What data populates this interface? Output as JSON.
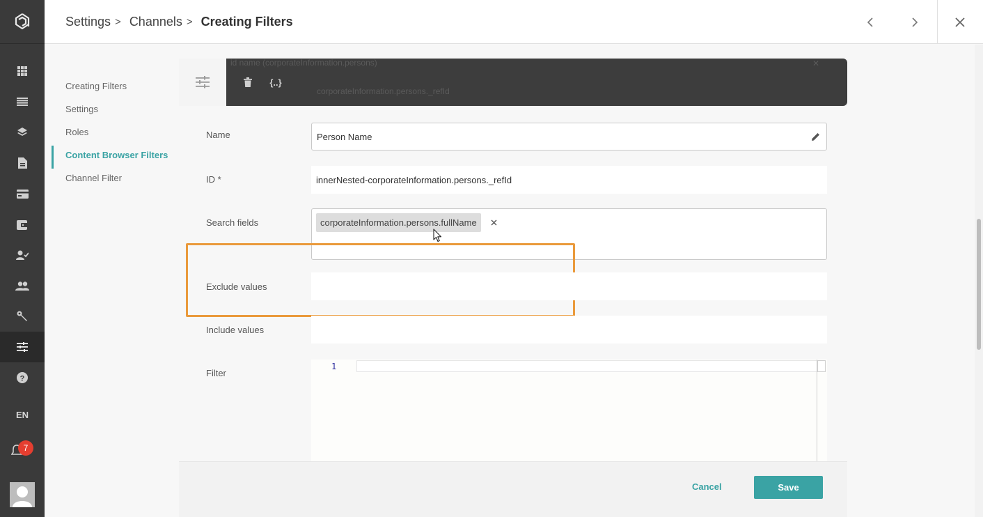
{
  "rail": {
    "icons": [
      "logo-icon",
      "grid-icon",
      "list-icon",
      "layers-icon",
      "document-icon",
      "card-icon",
      "wallet-icon",
      "person-check-icon",
      "people-icon",
      "wrench-icon",
      "sliders-icon",
      "help-icon"
    ],
    "active_item": "sliders-icon",
    "language": "EN",
    "notifications_count": "7"
  },
  "header": {
    "breadcrumb": [
      "Settings",
      "Channels"
    ],
    "current": "Creating Filters",
    "separator": ">"
  },
  "subnav": {
    "items": [
      "Creating Filters",
      "Settings",
      "Roles",
      "Content Browser Filters",
      "Channel Filter"
    ],
    "active": "Content Browser Filters"
  },
  "toolbar": {
    "ghost_text_1": "id name (corporateInformation.persons)",
    "ghost_text_2": "corporateInformation.persons._refId",
    "json_button": "{..}"
  },
  "form": {
    "name_label": "Name",
    "name_value": "Person Name",
    "id_label": "ID *",
    "id_value": "innerNested-corporateInformation.persons._refId",
    "search_fields_label": "Search fields",
    "search_fields_chip": "corporateInformation.persons.fullName",
    "exclude_label": "Exclude values",
    "include_label": "Include values",
    "filter_label": "Filter",
    "editor_line_number": "1"
  },
  "footer": {
    "cancel_label": "Cancel",
    "save_label": "Save"
  },
  "colors": {
    "accent": "#3aa3a4",
    "highlight": "#ea9a3c",
    "rail": "#3a3a3a",
    "toolbar": "#3d3d3d",
    "badge": "#e53e30"
  }
}
